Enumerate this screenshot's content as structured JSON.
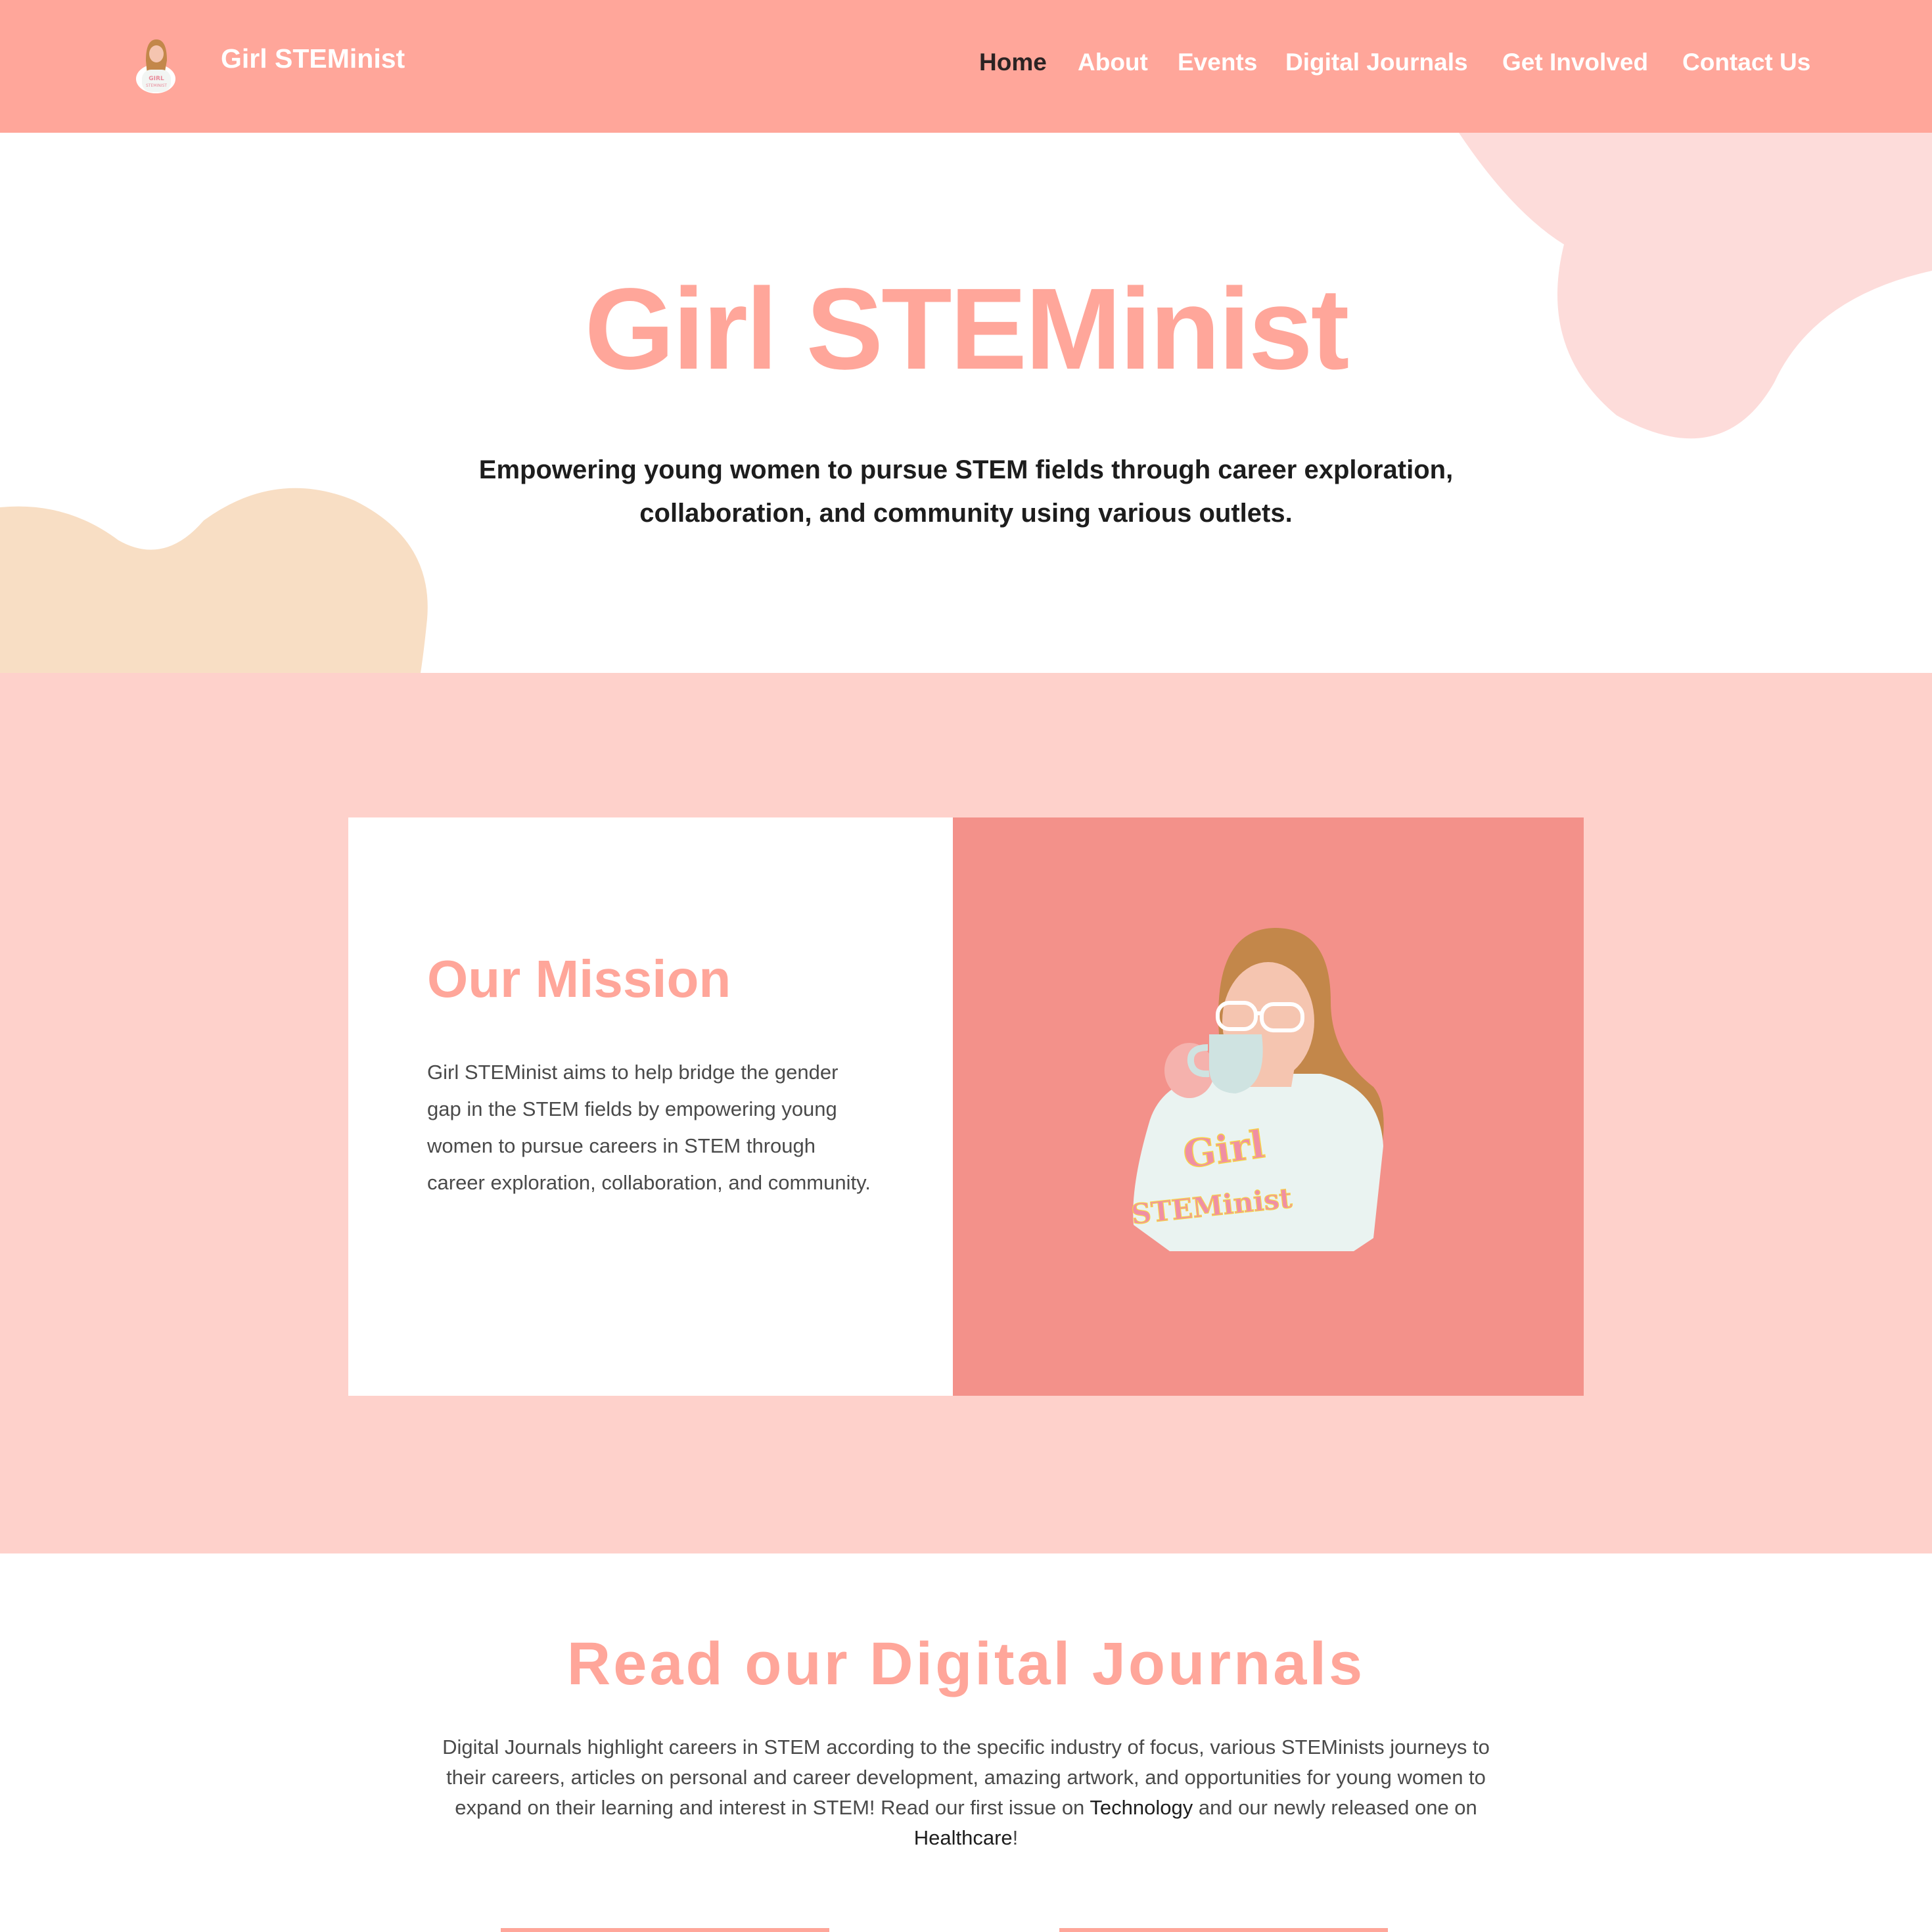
{
  "header": {
    "site_name": "Girl STEMinist",
    "nav": [
      {
        "label": "Home",
        "active": true
      },
      {
        "label": "About"
      },
      {
        "label": "Events"
      },
      {
        "label": "Digital Journals"
      },
      {
        "label": "Get Involved"
      },
      {
        "label": "Contact Us"
      }
    ]
  },
  "hero": {
    "title": "Girl STEMinist",
    "subtitle": "Empowering young women to pursue STEM fields through career exploration, collaboration, and community using various outlets."
  },
  "mission": {
    "title": "Our Mission",
    "text": "Girl STEMinist aims to help bridge the gender gap in the STEM fields by empowering young women to pursue careers in STEM through career exploration, collaboration, and community.",
    "illustration_text_line1": "Girl",
    "illustration_text_line2": "STEMinist"
  },
  "journals": {
    "title": "Read our Digital Journals",
    "text_before": "Digital Journals highlight careers in STEM according to the specific industry of focus, various STEMinists journeys to their careers, articles on personal and career development, amazing artwork, and opportunities for young women to expand on their learning and interest in STEM! Read our first issue on ",
    "link_technology": "Technology",
    "text_middle": " and our newly released one on ",
    "link_healthcare": "Healthcare",
    "text_after": "!"
  },
  "colors": {
    "brand": "#ffa69a",
    "section_bg": "#fed1cb",
    "illustration_bg": "#f3918a",
    "blob_pink": "#fddcda",
    "blob_peach": "#f8dec4"
  }
}
